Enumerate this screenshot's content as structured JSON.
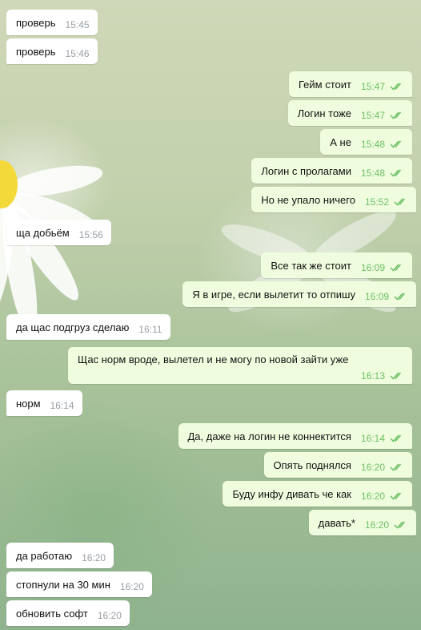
{
  "theme": {
    "outgoing_bg": "#effdde",
    "incoming_bg": "#ffffff",
    "outgoing_time_color": "#6cbf64",
    "incoming_time_color": "#9aa0a6"
  },
  "messages": [
    {
      "dir": "in",
      "text": "проверь",
      "time": "15:45"
    },
    {
      "dir": "in",
      "text": "проверь",
      "time": "15:46"
    },
    {
      "dir": "out",
      "text": "Гейм стоит",
      "time": "15:47",
      "status": "read"
    },
    {
      "dir": "out",
      "text": "Логин тоже",
      "time": "15:47",
      "status": "read"
    },
    {
      "dir": "out",
      "text": "А не",
      "time": "15:48",
      "status": "read"
    },
    {
      "dir": "out",
      "text": "Логин с пролагами",
      "time": "15:48",
      "status": "read"
    },
    {
      "dir": "out",
      "text": "Но не упало ничего",
      "time": "15:52",
      "status": "read"
    },
    {
      "dir": "in",
      "text": "ща добьём",
      "time": "15:56"
    },
    {
      "dir": "out",
      "text": "Все так же стоит",
      "time": "16:09",
      "status": "read"
    },
    {
      "dir": "out",
      "text": "Я в игре, если вылетит то отпишу",
      "time": "16:09",
      "status": "read"
    },
    {
      "dir": "in",
      "text": "да щас подгруз сделаю",
      "time": "16:11"
    },
    {
      "dir": "out",
      "text": "Щас норм вроде, вылетел и не могу по новой зайти уже",
      "time": "16:13",
      "status": "read"
    },
    {
      "dir": "in",
      "text": "норм",
      "time": "16:14"
    },
    {
      "dir": "out",
      "text": "Да, даже на логин не коннектится",
      "time": "16:14",
      "status": "read"
    },
    {
      "dir": "out",
      "text": "Опять поднялся",
      "time": "16:20",
      "status": "read"
    },
    {
      "dir": "out",
      "text": "Буду инфу дивать че как",
      "time": "16:20",
      "status": "read"
    },
    {
      "dir": "out",
      "text": "давать*",
      "time": "16:20",
      "status": "read"
    },
    {
      "dir": "in",
      "text": "да работаю",
      "time": "16:20"
    },
    {
      "dir": "in",
      "text": "стопнули на 30 мин",
      "time": "16:20"
    },
    {
      "dir": "in",
      "text": "обновить софт",
      "time": "16:20"
    }
  ]
}
